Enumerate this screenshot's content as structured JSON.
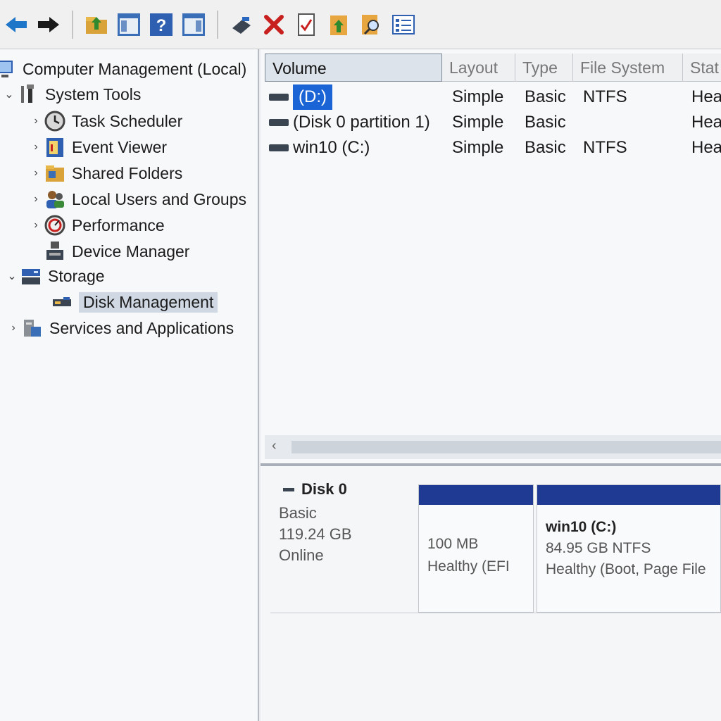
{
  "toolbar": {
    "buttons": [
      {
        "name": "back-icon"
      },
      {
        "name": "forward-icon"
      },
      {
        "name": "up-folder-icon"
      },
      {
        "name": "show-hide-console-tree-icon"
      },
      {
        "name": "help-icon"
      },
      {
        "name": "show-hide-action-pane-icon"
      },
      {
        "name": "connect-drive-icon"
      },
      {
        "name": "delete-icon"
      },
      {
        "name": "properties-icon"
      },
      {
        "name": "export-icon"
      },
      {
        "name": "search-icon"
      },
      {
        "name": "list-view-icon"
      }
    ]
  },
  "tree": {
    "root": "Computer Management (Local)",
    "items": [
      {
        "label": "System Tools",
        "level": 1,
        "expander": "expanded"
      },
      {
        "label": "Task Scheduler",
        "level": 2,
        "expander": "collapsed"
      },
      {
        "label": "Event Viewer",
        "level": 2,
        "expander": "collapsed"
      },
      {
        "label": "Shared Folders",
        "level": 2,
        "expander": "collapsed"
      },
      {
        "label": "Local Users and Groups",
        "level": 2,
        "expander": "collapsed"
      },
      {
        "label": "Performance",
        "level": 2,
        "expander": "collapsed"
      },
      {
        "label": "Device Manager",
        "level": 2,
        "expander": "none"
      },
      {
        "label": "Storage",
        "level": 1,
        "expander": "expanded"
      },
      {
        "label": "Disk Management",
        "level": 2,
        "expander": "none",
        "selected": true
      },
      {
        "label": "Services and Applications",
        "level": 1,
        "expander": "collapsed"
      }
    ]
  },
  "volumes": {
    "columns": [
      "Volume",
      "Layout",
      "Type",
      "File System",
      "Stat"
    ],
    "rows": [
      {
        "volume": "(D:)",
        "layout": "Simple",
        "type": "Basic",
        "fs": "NTFS",
        "status": "Hea",
        "selected": true
      },
      {
        "volume": "(Disk 0 partition 1)",
        "layout": "Simple",
        "type": "Basic",
        "fs": "",
        "status": "Hea"
      },
      {
        "volume": "win10 (C:)",
        "layout": "Simple",
        "type": "Basic",
        "fs": "NTFS",
        "status": "Hea"
      }
    ],
    "scroll_left": "‹"
  },
  "disk_map": {
    "disk": {
      "name": "Disk 0",
      "type": "Basic",
      "size": "119.24 GB",
      "state": "Online"
    },
    "partitions": [
      {
        "title": "",
        "line1": "100 MB",
        "line2": "Healthy (EFI"
      },
      {
        "title": "win10  (C:)",
        "line1": "84.95 GB NTFS",
        "line2": "Healthy (Boot, Page File"
      }
    ]
  },
  "colors": {
    "selection": "#1a64d6",
    "partition_bar": "#1f3a93"
  }
}
